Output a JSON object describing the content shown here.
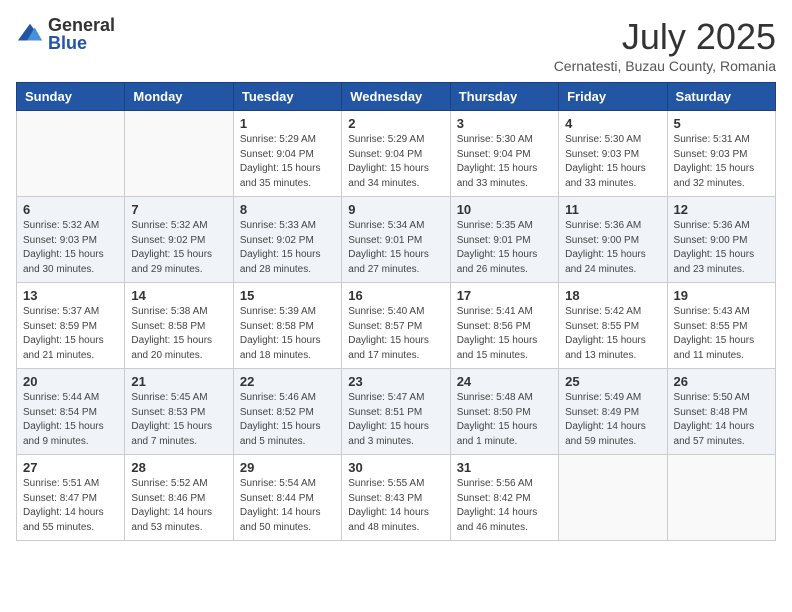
{
  "logo": {
    "general": "General",
    "blue": "Blue"
  },
  "title": "July 2025",
  "subtitle": "Cernatesti, Buzau County, Romania",
  "headers": [
    "Sunday",
    "Monday",
    "Tuesday",
    "Wednesday",
    "Thursday",
    "Friday",
    "Saturday"
  ],
  "weeks": [
    [
      {
        "day": "",
        "info": ""
      },
      {
        "day": "",
        "info": ""
      },
      {
        "day": "1",
        "info": "Sunrise: 5:29 AM\nSunset: 9:04 PM\nDaylight: 15 hours and 35 minutes."
      },
      {
        "day": "2",
        "info": "Sunrise: 5:29 AM\nSunset: 9:04 PM\nDaylight: 15 hours and 34 minutes."
      },
      {
        "day": "3",
        "info": "Sunrise: 5:30 AM\nSunset: 9:04 PM\nDaylight: 15 hours and 33 minutes."
      },
      {
        "day": "4",
        "info": "Sunrise: 5:30 AM\nSunset: 9:03 PM\nDaylight: 15 hours and 33 minutes."
      },
      {
        "day": "5",
        "info": "Sunrise: 5:31 AM\nSunset: 9:03 PM\nDaylight: 15 hours and 32 minutes."
      }
    ],
    [
      {
        "day": "6",
        "info": "Sunrise: 5:32 AM\nSunset: 9:03 PM\nDaylight: 15 hours and 30 minutes."
      },
      {
        "day": "7",
        "info": "Sunrise: 5:32 AM\nSunset: 9:02 PM\nDaylight: 15 hours and 29 minutes."
      },
      {
        "day": "8",
        "info": "Sunrise: 5:33 AM\nSunset: 9:02 PM\nDaylight: 15 hours and 28 minutes."
      },
      {
        "day": "9",
        "info": "Sunrise: 5:34 AM\nSunset: 9:01 PM\nDaylight: 15 hours and 27 minutes."
      },
      {
        "day": "10",
        "info": "Sunrise: 5:35 AM\nSunset: 9:01 PM\nDaylight: 15 hours and 26 minutes."
      },
      {
        "day": "11",
        "info": "Sunrise: 5:36 AM\nSunset: 9:00 PM\nDaylight: 15 hours and 24 minutes."
      },
      {
        "day": "12",
        "info": "Sunrise: 5:36 AM\nSunset: 9:00 PM\nDaylight: 15 hours and 23 minutes."
      }
    ],
    [
      {
        "day": "13",
        "info": "Sunrise: 5:37 AM\nSunset: 8:59 PM\nDaylight: 15 hours and 21 minutes."
      },
      {
        "day": "14",
        "info": "Sunrise: 5:38 AM\nSunset: 8:58 PM\nDaylight: 15 hours and 20 minutes."
      },
      {
        "day": "15",
        "info": "Sunrise: 5:39 AM\nSunset: 8:58 PM\nDaylight: 15 hours and 18 minutes."
      },
      {
        "day": "16",
        "info": "Sunrise: 5:40 AM\nSunset: 8:57 PM\nDaylight: 15 hours and 17 minutes."
      },
      {
        "day": "17",
        "info": "Sunrise: 5:41 AM\nSunset: 8:56 PM\nDaylight: 15 hours and 15 minutes."
      },
      {
        "day": "18",
        "info": "Sunrise: 5:42 AM\nSunset: 8:55 PM\nDaylight: 15 hours and 13 minutes."
      },
      {
        "day": "19",
        "info": "Sunrise: 5:43 AM\nSunset: 8:55 PM\nDaylight: 15 hours and 11 minutes."
      }
    ],
    [
      {
        "day": "20",
        "info": "Sunrise: 5:44 AM\nSunset: 8:54 PM\nDaylight: 15 hours and 9 minutes."
      },
      {
        "day": "21",
        "info": "Sunrise: 5:45 AM\nSunset: 8:53 PM\nDaylight: 15 hours and 7 minutes."
      },
      {
        "day": "22",
        "info": "Sunrise: 5:46 AM\nSunset: 8:52 PM\nDaylight: 15 hours and 5 minutes."
      },
      {
        "day": "23",
        "info": "Sunrise: 5:47 AM\nSunset: 8:51 PM\nDaylight: 15 hours and 3 minutes."
      },
      {
        "day": "24",
        "info": "Sunrise: 5:48 AM\nSunset: 8:50 PM\nDaylight: 15 hours and 1 minute."
      },
      {
        "day": "25",
        "info": "Sunrise: 5:49 AM\nSunset: 8:49 PM\nDaylight: 14 hours and 59 minutes."
      },
      {
        "day": "26",
        "info": "Sunrise: 5:50 AM\nSunset: 8:48 PM\nDaylight: 14 hours and 57 minutes."
      }
    ],
    [
      {
        "day": "27",
        "info": "Sunrise: 5:51 AM\nSunset: 8:47 PM\nDaylight: 14 hours and 55 minutes."
      },
      {
        "day": "28",
        "info": "Sunrise: 5:52 AM\nSunset: 8:46 PM\nDaylight: 14 hours and 53 minutes."
      },
      {
        "day": "29",
        "info": "Sunrise: 5:54 AM\nSunset: 8:44 PM\nDaylight: 14 hours and 50 minutes."
      },
      {
        "day": "30",
        "info": "Sunrise: 5:55 AM\nSunset: 8:43 PM\nDaylight: 14 hours and 48 minutes."
      },
      {
        "day": "31",
        "info": "Sunrise: 5:56 AM\nSunset: 8:42 PM\nDaylight: 14 hours and 46 minutes."
      },
      {
        "day": "",
        "info": ""
      },
      {
        "day": "",
        "info": ""
      }
    ]
  ]
}
